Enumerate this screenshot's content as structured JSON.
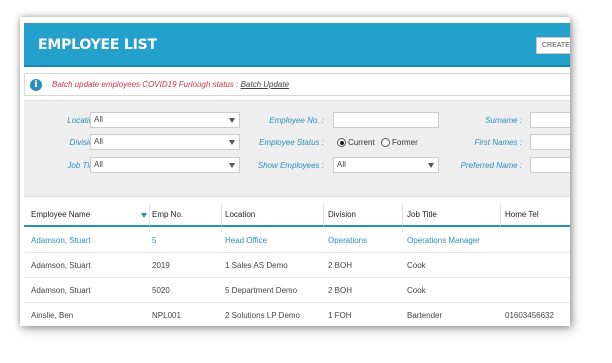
{
  "header": {
    "title": "EMPLOYEE LIST",
    "create_label": "CREATE"
  },
  "notice": {
    "icon": "info-icon",
    "text": "Batch update employees COVID19 Furlough status :",
    "link": "Batch Update"
  },
  "filters": {
    "location": {
      "label": "Location :",
      "value": "All"
    },
    "division": {
      "label": "Division :",
      "value": "All"
    },
    "job_title": {
      "label": "Job Title :",
      "value": "All"
    },
    "employee_no": {
      "label": "Employee No. :",
      "value": ""
    },
    "employee_status": {
      "label": "Employee Status :",
      "options": [
        "Current",
        "Former"
      ],
      "selected": "Current"
    },
    "show_employees": {
      "label": "Show Employees :",
      "value": "All"
    },
    "surname": {
      "label": "Surname :",
      "value": ""
    },
    "first_names": {
      "label": "First Names :",
      "value": ""
    },
    "preferred_name": {
      "label": "Preferred Name :",
      "value": ""
    }
  },
  "table": {
    "columns": [
      "Employee Name",
      "Emp No.",
      "Location",
      "Division",
      "Job Title",
      "Home Tel"
    ],
    "rows": [
      [
        "Adamson, Stuart",
        "5",
        "Head Office",
        "Operations",
        "Operations Manager",
        ""
      ],
      [
        "Adamson, Stuart",
        "2019",
        "1 Sales AS Demo",
        "2 BOH",
        "Cook",
        ""
      ],
      [
        "Adamson, Stuart",
        "5020",
        "5 Department Demo",
        "2 BOH",
        "Cook",
        ""
      ],
      [
        "Ainslie, Ben",
        "NPL001",
        "2 Solutions LP Demo",
        "1 FOH",
        "Bartender",
        "01603456632"
      ]
    ]
  },
  "colors": {
    "accent": "#23a0cc",
    "link": "#2a8fbf",
    "notice_text": "#c9374a"
  }
}
